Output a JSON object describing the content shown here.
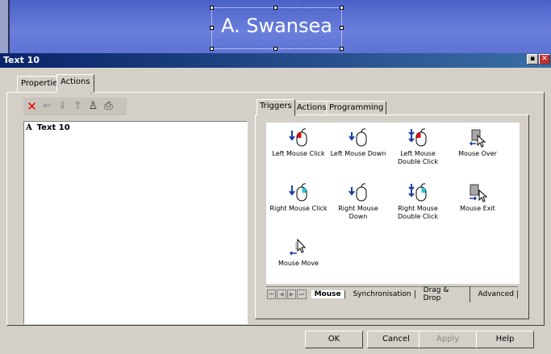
{
  "canvas": {
    "title_text": "A. Swansea"
  },
  "window": {
    "title": "Text 10",
    "minimize_label": "▪",
    "close_label": "✕"
  },
  "outer_tabs": [
    {
      "label": "Properties"
    },
    {
      "label": "Actions"
    }
  ],
  "toolbar": {
    "icons": [
      "delete-icon",
      "back-arrow-icon",
      "down-arrow-icon",
      "up-arrow-icon",
      "person-icon",
      "print-icon"
    ]
  },
  "left_list": {
    "items": [
      {
        "prefix": "A",
        "label": "Text 10"
      }
    ]
  },
  "right_tabs": [
    {
      "label": "Triggers"
    },
    {
      "label": "Actions"
    },
    {
      "label": "Programming"
    }
  ],
  "triggers": [
    {
      "label": "Left Mouse Click",
      "icon": "left-click-icon"
    },
    {
      "label": "Left Mouse Down",
      "icon": "left-down-icon"
    },
    {
      "label": "Left Mouse Double Click",
      "icon": "left-double-icon"
    },
    {
      "label": "Mouse Over",
      "icon": "mouse-over-icon"
    },
    {
      "label": "Right Mouse Click",
      "icon": "right-click-icon"
    },
    {
      "label": "Right Mouse Down",
      "icon": "right-down-icon"
    },
    {
      "label": "Right Mouse Double Click",
      "icon": "right-double-icon"
    },
    {
      "label": "Mouse Exit",
      "icon": "mouse-exit-icon"
    },
    {
      "label": "Mouse Move",
      "icon": "mouse-move-icon"
    }
  ],
  "bottom_tabs": [
    {
      "label": "Mouse"
    },
    {
      "label": "Synchronisation"
    },
    {
      "label": "Drag & Drop"
    },
    {
      "label": "Advanced"
    }
  ],
  "buttons": {
    "ok": "OK",
    "cancel": "Cancel",
    "apply": "Apply",
    "help": "Help"
  },
  "colors": {
    "canvas_blue": "#5d72d3",
    "titlebar": "#0a246a",
    "delete_red": "#e00000"
  }
}
